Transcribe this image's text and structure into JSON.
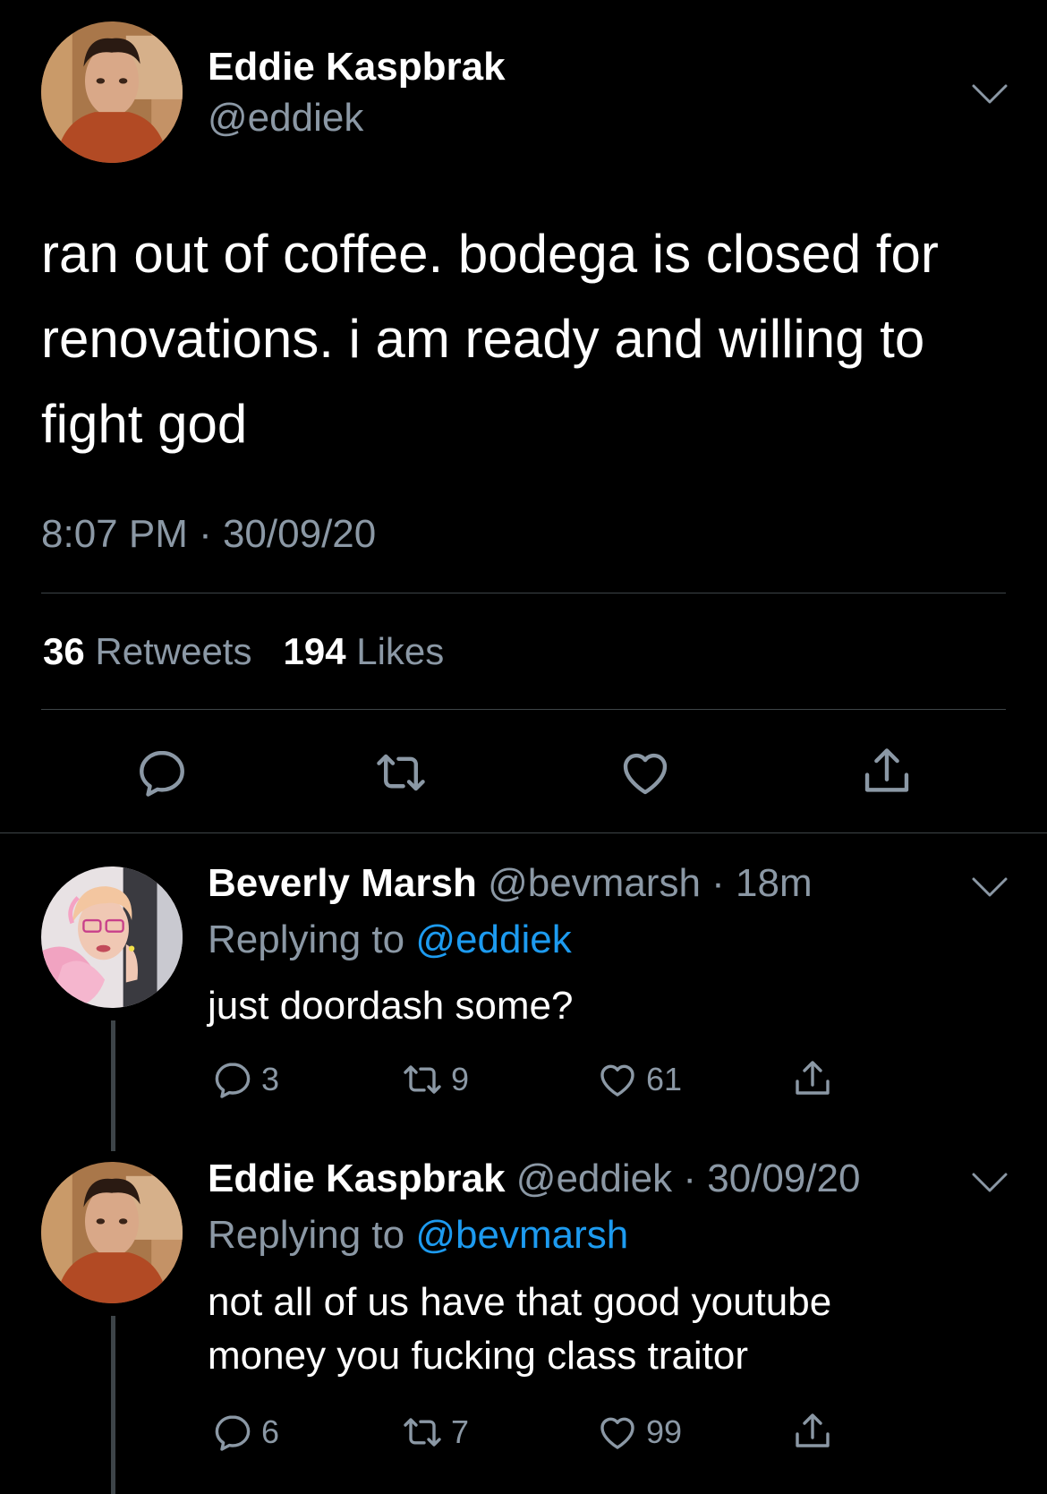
{
  "main_tweet": {
    "author": {
      "name": "Eddie Kaspbrak",
      "handle": "@eddiek",
      "avatar": "avatar-eddie"
    },
    "text_lines": [
      "ran out of coffee. bodega is closed for",
      "renovations. i am ready and willing to",
      "fight god"
    ],
    "timestamp": "8:07 PM · 30/09/20",
    "stats": {
      "retweets_count": "36",
      "retweets_label": "Retweets",
      "likes_count": "194",
      "likes_label": "Likes"
    },
    "actions": [
      "reply-icon",
      "retweet-icon",
      "like-icon",
      "share-icon"
    ]
  },
  "replies": [
    {
      "name": "Beverly Marsh",
      "meta": "@bevmarsh · 18m",
      "replying_prefix": "Replying to",
      "replying_to": "@eddiek",
      "text_lines": [
        "just doordash some?"
      ],
      "counts": {
        "reply": "3",
        "retweet": "9",
        "like": "61"
      },
      "avatar": "avatar-beverly"
    },
    {
      "name": "Eddie Kaspbrak",
      "meta": "@eddiek · 30/09/20",
      "replying_prefix": "Replying to",
      "replying_to": "@bevmarsh",
      "text_lines": [
        "not all of us have that good youtube",
        "money you fucking class traitor"
      ],
      "counts": {
        "reply": "6",
        "retweet": "7",
        "like": "99"
      },
      "avatar": "avatar-eddie"
    }
  ],
  "colors": {
    "background": "#000000",
    "text": "#ffffff",
    "secondary_text": "#8b98a5",
    "mention": "#1d9bf0",
    "divider": "#3d4448"
  }
}
